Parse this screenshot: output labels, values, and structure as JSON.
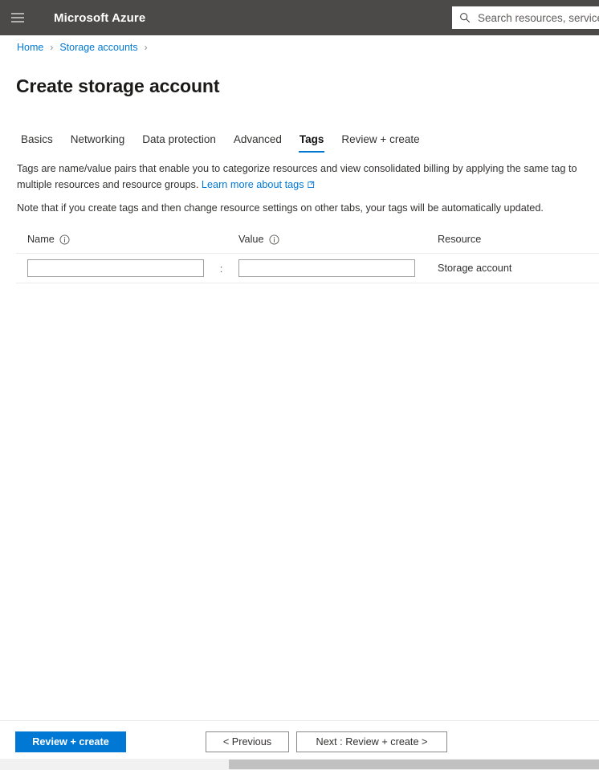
{
  "topbar": {
    "menu_icon": "hamburger-icon",
    "brand": "Microsoft Azure",
    "search": {
      "icon": "search-icon",
      "placeholder": "Search resources, services, a",
      "value": ""
    }
  },
  "breadcrumb": {
    "items": [
      {
        "label": "Home",
        "is_link": true
      },
      {
        "label": "Storage accounts",
        "is_link": true
      }
    ],
    "separator": "›",
    "trailing_separator": "›"
  },
  "page": {
    "title": "Create storage account"
  },
  "tabs": [
    {
      "label": "Basics",
      "active": false
    },
    {
      "label": "Networking",
      "active": false
    },
    {
      "label": "Data protection",
      "active": false
    },
    {
      "label": "Advanced",
      "active": false
    },
    {
      "label": "Tags",
      "active": true
    },
    {
      "label": "Review + create",
      "active": false
    }
  ],
  "description": {
    "paragraph1_before_link": "Tags are name/value pairs that enable you to categorize resources and view consolidated billing by applying the same tag to multiple resources and resource groups.",
    "link_label": "Learn more about tags",
    "link_icon": "external-link-icon",
    "paragraph2": "Note that if you create tags and then change resource settings on other tabs, your tags will be automatically updated."
  },
  "tag_table": {
    "headers": {
      "name": "Name",
      "name_info_icon": "info-icon",
      "value": "Value",
      "value_info_icon": "info-icon",
      "resource": "Resource"
    },
    "separator": ":",
    "rows": [
      {
        "name_value": "",
        "name_placeholder": "",
        "value_value": "",
        "value_placeholder": "",
        "resource": "Storage account"
      }
    ]
  },
  "footer": {
    "review_create_label": "Review + create",
    "previous_label": "< Previous",
    "next_label": "Next : Review + create >"
  },
  "scrollbar": {
    "orientation": "horizontal"
  },
  "colors": {
    "accent": "#0078d4",
    "header_bg": "#4b4a49",
    "link": "#0078d4",
    "text": "#323130",
    "border": "#edebe9",
    "input_border": "#a19f9d"
  }
}
